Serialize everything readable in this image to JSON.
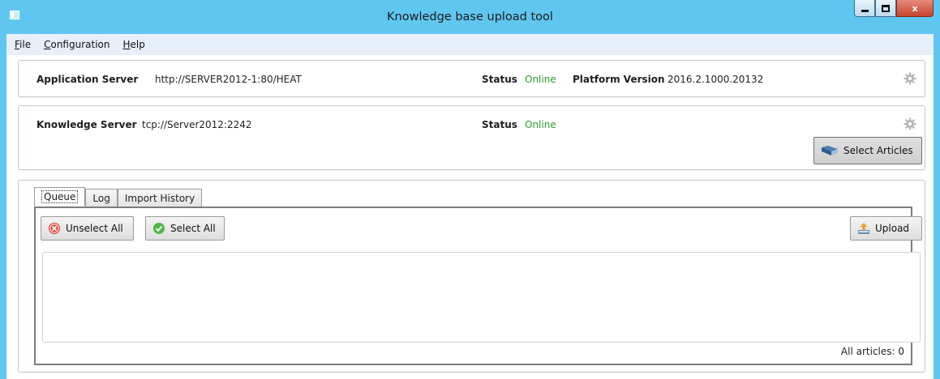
{
  "window": {
    "title": "Knowledge base upload tool",
    "controls": {
      "minimize": "minimize",
      "maximize": "maximize",
      "close": "x"
    }
  },
  "menu": {
    "items": [
      {
        "label": "File",
        "mnemonic": "F",
        "rest": "ile"
      },
      {
        "label": "Configuration",
        "mnemonic": "C",
        "rest": "onfiguration"
      },
      {
        "label": "Help",
        "mnemonic": "H",
        "rest": "elp"
      }
    ]
  },
  "app_server": {
    "label": "Application Server",
    "value": "http://SERVER2012-1:80/HEAT",
    "status_label": "Status",
    "status_value": "Online",
    "platform_label": "Platform Version",
    "platform_value": "2016.2.1000.20132",
    "settings_icon": "gear-icon"
  },
  "knowledge_server": {
    "label": "Knowledge Server",
    "value": "tcp://Server2012:2242",
    "status_label": "Status",
    "status_value": "Online",
    "settings_icon": "gear-icon",
    "select_articles_label": "Select Articles",
    "select_articles_icon": "book-icon"
  },
  "tabs": [
    {
      "label": "Queue",
      "active": true
    },
    {
      "label": "Log",
      "active": false
    },
    {
      "label": "Import History",
      "active": false
    }
  ],
  "queue": {
    "unselect_all_label": "Unselect All",
    "unselect_all_icon": "red-x-circle-icon",
    "select_all_label": "Select All",
    "select_all_icon": "green-check-circle-icon",
    "upload_label": "Upload",
    "upload_icon": "upload-icon",
    "count_text": "All articles: 0"
  },
  "colors": {
    "titlebar": "#5fc7ef",
    "menubar": "#e7effa",
    "online": "#2e9b2e",
    "close_button": "#c7442f"
  }
}
